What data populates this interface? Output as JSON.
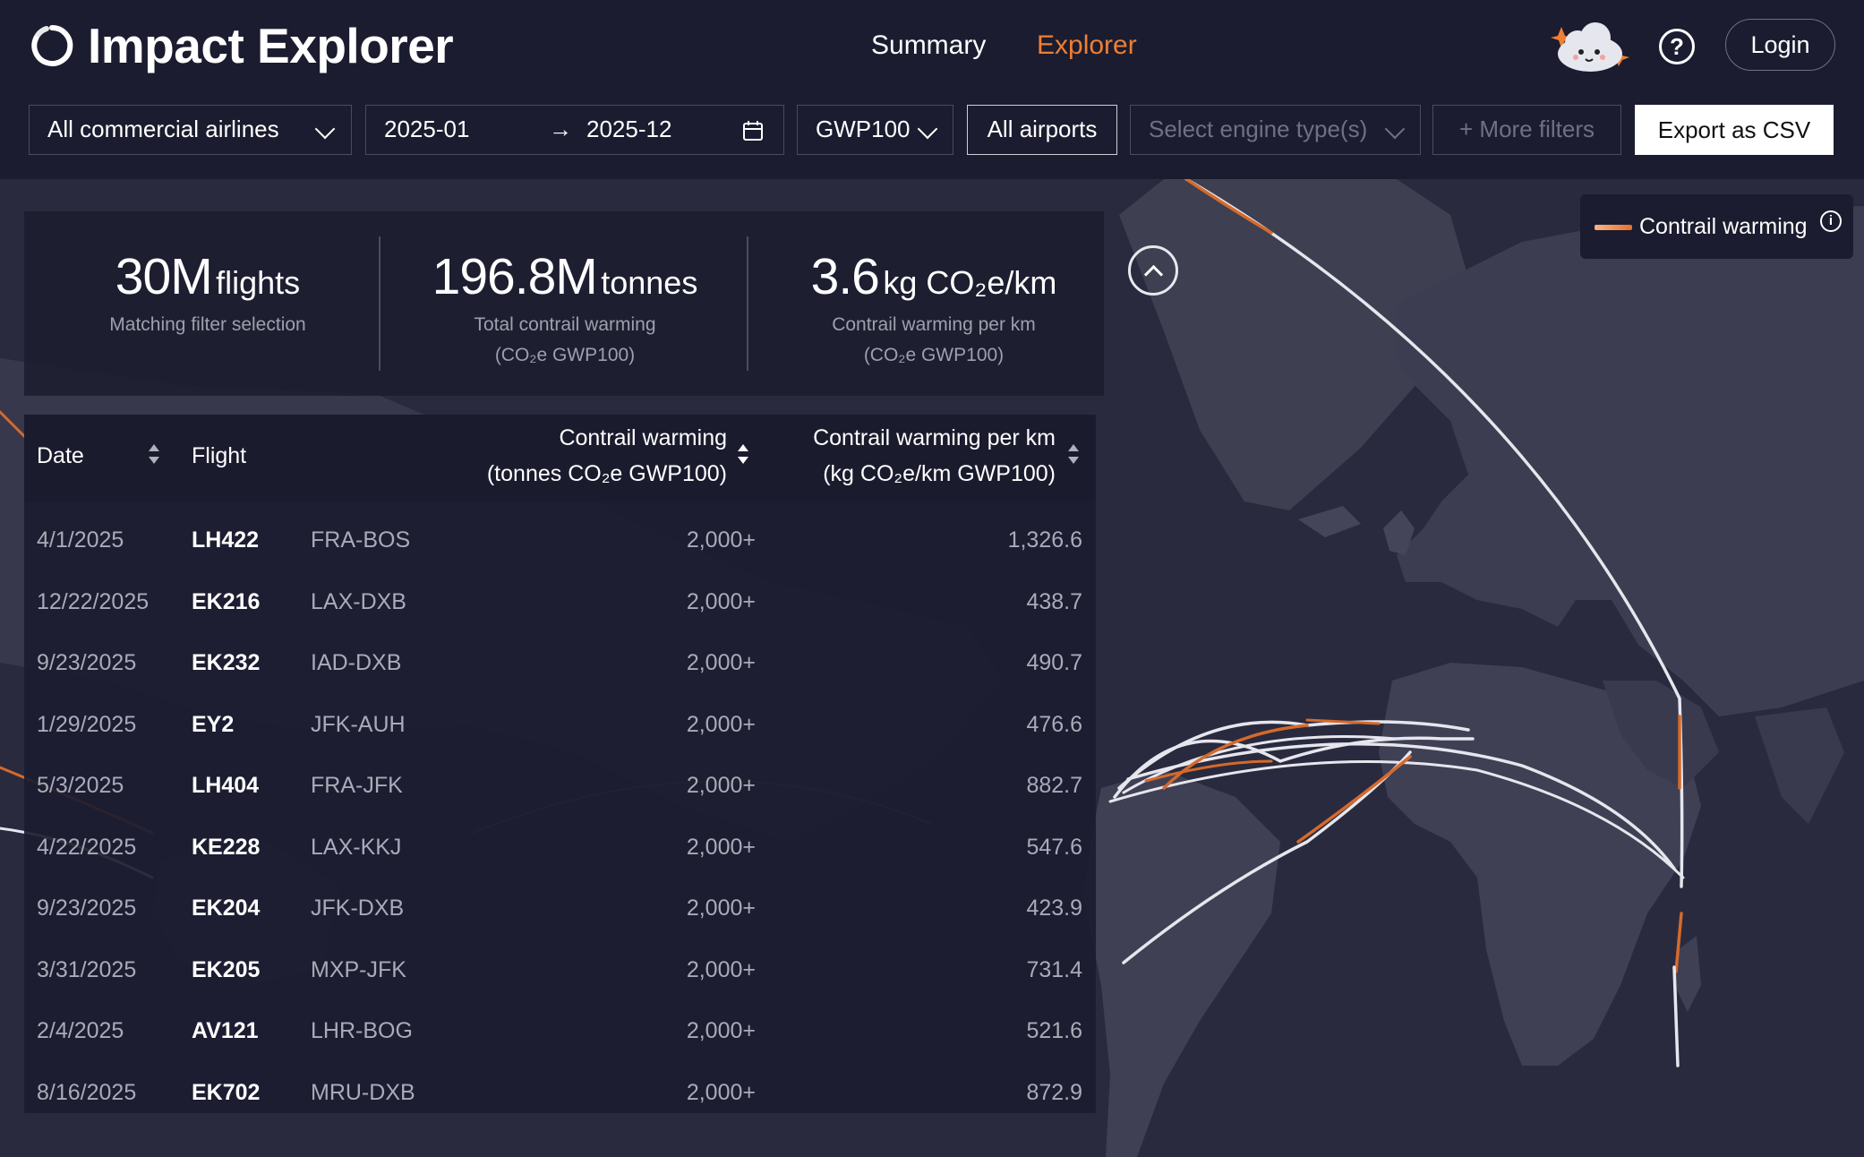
{
  "brand": {
    "name": "Impact Explorer"
  },
  "nav": {
    "summary": "Summary",
    "explorer": "Explorer"
  },
  "header": {
    "login": "Login",
    "help_icon": "?"
  },
  "filters": {
    "airlines": "All commercial airlines",
    "date_start": "2025-01",
    "date_end": "2025-12",
    "date_arrow": "→",
    "metric": "GWP100",
    "airports": "All airports",
    "engine_placeholder": "Select engine type(s)",
    "more_filters": "+ More filters",
    "export": "Export as CSV"
  },
  "legend": {
    "label": "Contrail warming",
    "info": "i"
  },
  "stats": [
    {
      "value": "30M",
      "unit": "flights",
      "line1": "Matching filter selection",
      "line2": ""
    },
    {
      "value": "196.8M",
      "unit": "tonnes",
      "line1": "Total contrail warming",
      "line2": "(CO₂e GWP100)"
    },
    {
      "value": "3.6",
      "unit": "kg CO₂e/km",
      "line1": "Contrail warming per km",
      "line2": "(CO₂e GWP100)"
    }
  ],
  "table": {
    "headers": {
      "date": "Date",
      "flight": "Flight",
      "warming_l1": "Contrail warming",
      "warming_l2": "(tonnes CO₂e GWP100)",
      "perkm_l1": "Contrail warming per km",
      "perkm_l2": "(kg CO₂e/km GWP100)"
    },
    "rows": [
      {
        "date": "4/1/2025",
        "flight": "LH422",
        "route": "FRA-BOS",
        "warming": "2,000+",
        "per_km": "1,326.6"
      },
      {
        "date": "12/22/2025",
        "flight": "EK216",
        "route": "LAX-DXB",
        "warming": "2,000+",
        "per_km": "438.7"
      },
      {
        "date": "9/23/2025",
        "flight": "EK232",
        "route": "IAD-DXB",
        "warming": "2,000+",
        "per_km": "490.7"
      },
      {
        "date": "1/29/2025",
        "flight": "EY2",
        "route": "JFK-AUH",
        "warming": "2,000+",
        "per_km": "476.6"
      },
      {
        "date": "5/3/2025",
        "flight": "LH404",
        "route": "FRA-JFK",
        "warming": "2,000+",
        "per_km": "882.7"
      },
      {
        "date": "4/22/2025",
        "flight": "KE228",
        "route": "LAX-KKJ",
        "warming": "2,000+",
        "per_km": "547.6"
      },
      {
        "date": "9/23/2025",
        "flight": "EK204",
        "route": "JFK-DXB",
        "warming": "2,000+",
        "per_km": "423.9"
      },
      {
        "date": "3/31/2025",
        "flight": "EK205",
        "route": "MXP-JFK",
        "warming": "2,000+",
        "per_km": "731.4"
      },
      {
        "date": "2/4/2025",
        "flight": "AV121",
        "route": "LHR-BOG",
        "warming": "2,000+",
        "per_km": "521.6"
      },
      {
        "date": "8/16/2025",
        "flight": "EK702",
        "route": "MRU-DXB",
        "warming": "2,000+",
        "per_km": "872.9"
      }
    ]
  },
  "colors": {
    "background": "#1b1c2f",
    "accent": "#ee7f33",
    "contrail": "#d46a2c",
    "flight_path": "#e6e6ee",
    "land": "#3f3f52",
    "ocean": "#2a2a3e"
  }
}
